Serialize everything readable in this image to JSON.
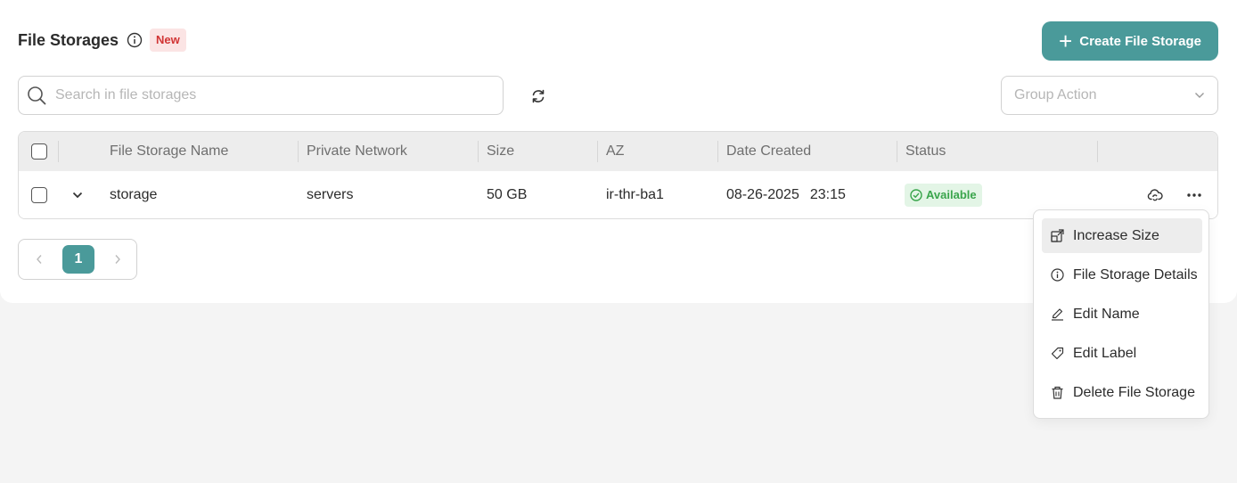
{
  "header": {
    "title": "File Storages",
    "badge": "New",
    "create_button_label": "Create File Storage"
  },
  "toolbar": {
    "search_placeholder": "Search in file storages",
    "group_action_placeholder": "Group Action"
  },
  "table": {
    "columns": [
      "File Storage Name",
      "Private Network",
      "Size",
      "AZ",
      "Date Created",
      "Status"
    ],
    "rows": [
      {
        "name": "storage",
        "private_network": "servers",
        "size": "50 GB",
        "az": "ir-thr-ba1",
        "date": "08-26-2025",
        "time": "23:15",
        "status": "Available"
      }
    ]
  },
  "pagination": {
    "current_page": "1"
  },
  "context_menu": {
    "items": [
      {
        "label": "Increase Size",
        "icon": "resize-icon"
      },
      {
        "label": "File Storage Details",
        "icon": "info-icon"
      },
      {
        "label": "Edit Name",
        "icon": "pencil-icon"
      },
      {
        "label": "Edit Label",
        "icon": "tag-icon"
      },
      {
        "label": "Delete File Storage",
        "icon": "trash-icon"
      }
    ]
  },
  "colors": {
    "accent": "#4a9a9a",
    "badge_bg": "#fbe4e4",
    "badge_text": "#d13434",
    "status_bg": "#e3f5e6",
    "status_text": "#3aa54c"
  }
}
